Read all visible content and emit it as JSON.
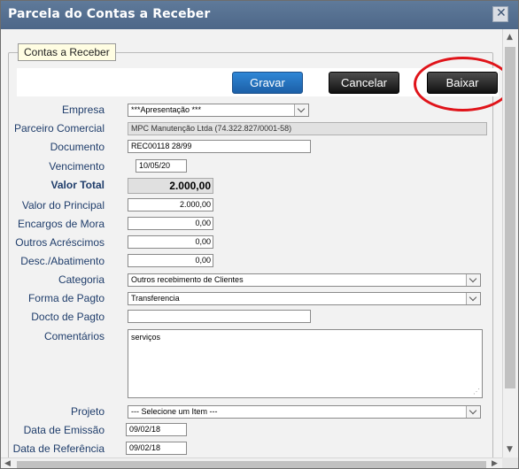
{
  "window": {
    "title": "Parcela do Contas a Receber",
    "close_glyph": "✕"
  },
  "section": {
    "legend": "Contas a Receber"
  },
  "toolbar": {
    "gravar_label": "Gravar",
    "cancelar_label": "Cancelar",
    "baixar_label": "Baixar"
  },
  "fields": {
    "empresa": {
      "label": "Empresa",
      "value": "***Apresentação ***"
    },
    "parceiro": {
      "label": "Parceiro Comercial",
      "value": "MPC Manutenção Ltda (74.322.827/0001-58)"
    },
    "documento": {
      "label": "Documento",
      "value": "REC00118 28/99"
    },
    "vencimento": {
      "label": "Vencimento",
      "value": "10/05/20"
    },
    "valor_total": {
      "label": "Valor Total",
      "value": "2.000,00"
    },
    "valor_principal": {
      "label": "Valor do Principal",
      "value": "2.000,00"
    },
    "encargos": {
      "label": "Encargos de Mora",
      "value": "0,00"
    },
    "outros": {
      "label": "Outros Acréscimos",
      "value": "0,00"
    },
    "desconto": {
      "label": "Desc./Abatimento",
      "value": "0,00"
    },
    "categoria": {
      "label": "Categoria",
      "value": "Outros recebimento de Clientes"
    },
    "forma_pagto": {
      "label": "Forma de Pagto",
      "value": "Transferencia"
    },
    "docto_pagto": {
      "label": "Docto de Pagto",
      "value": ""
    },
    "comentarios": {
      "label": "Comentários",
      "value": "serviços"
    },
    "projeto": {
      "label": "Projeto",
      "value": "--- Selecione um Item ---"
    },
    "data_emissao": {
      "label": "Data de Emissão",
      "value": "09/02/18"
    },
    "data_referencia": {
      "label": "Data de Referência",
      "value": "09/02/18"
    }
  },
  "colors": {
    "titlebar": "#5f7a9a",
    "label": "#1f3d6b",
    "primary_button": "#1c5fa7",
    "dark_button": "#111111",
    "annotation": "#e0141a"
  },
  "icons": {
    "close": "close-icon",
    "dropdown": "chevron-down-icon",
    "resize": "resize-grip-icon"
  }
}
